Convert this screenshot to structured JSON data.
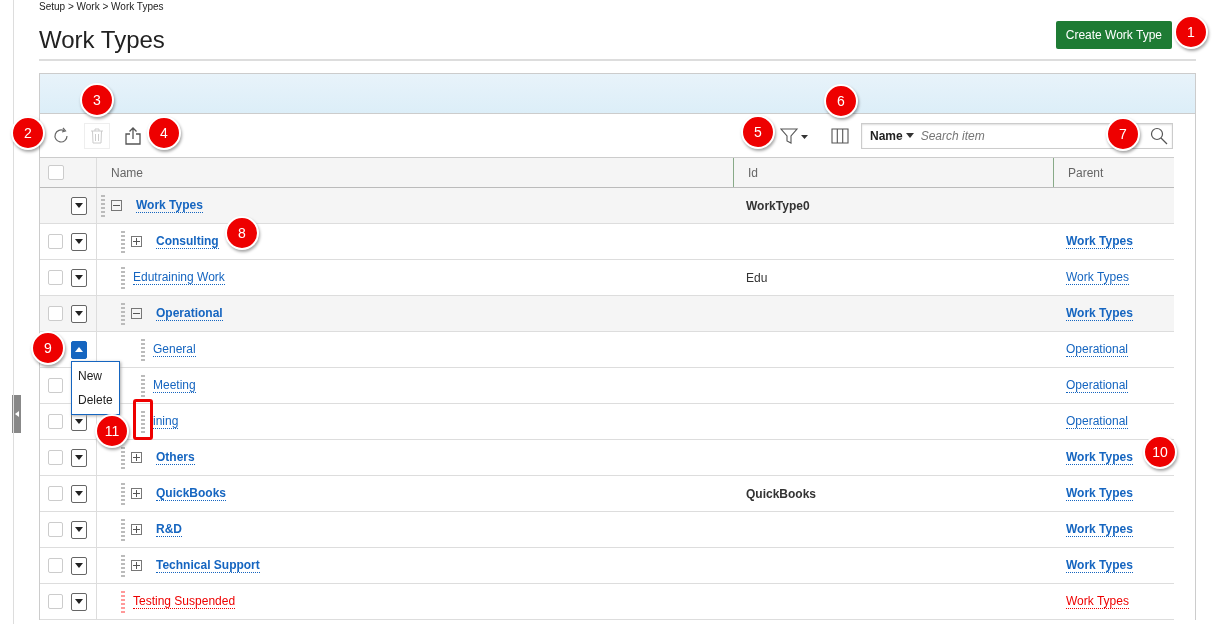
{
  "breadcrumb": "Setup > Work > Work Types",
  "title": "Work Types",
  "create_button": "Create Work Type",
  "search": {
    "field": "Name",
    "placeholder": "Search item"
  },
  "columns": [
    "Name",
    "Id",
    "Parent"
  ],
  "select_all_checked": false,
  "tree": [
    {
      "name": "Work Types",
      "id": "WorkType0",
      "expandable": true,
      "expanded": true,
      "suspended": false,
      "menu_open": false,
      "children": [
        {
          "name": "Consulting",
          "parent": "Work Types",
          "expandable": true,
          "expanded": false,
          "suspended": false,
          "checked": false,
          "menu_open": false
        },
        {
          "name": "Edutraining Work",
          "id": "Edu",
          "parent": "Work Types",
          "expandable": false,
          "expanded": false,
          "suspended": false,
          "checked": false,
          "menu_open": false
        },
        {
          "name": "Operational",
          "parent": "Work Types",
          "expandable": true,
          "expanded": true,
          "suspended": false,
          "checked": false,
          "menu_open": false,
          "children": [
            {
              "name": "General",
              "parent": "Operational",
              "expandable": false,
              "expanded": false,
              "suspended": false,
              "menu_open": true,
              "menu": [
                "New",
                "Delete"
              ]
            },
            {
              "name": "Meeting",
              "parent": "Operational",
              "expandable": false,
              "expanded": false,
              "suspended": false,
              "checked": false
            },
            {
              "name": "ining",
              "parent": "Operational",
              "expandable": false,
              "expanded": false,
              "suspended": false,
              "checked": false,
              "menu_open": false
            }
          ]
        },
        {
          "name": "Others",
          "parent": "Work Types",
          "expandable": true,
          "expanded": false,
          "suspended": false,
          "checked": false,
          "menu_open": false
        },
        {
          "name": "QuickBooks",
          "id": "QuickBooks",
          "parent": "Work Types",
          "expandable": true,
          "expanded": false,
          "suspended": false,
          "checked": false,
          "menu_open": false
        },
        {
          "name": "R&D",
          "parent": "Work Types",
          "expandable": true,
          "expanded": false,
          "suspended": false,
          "checked": false,
          "menu_open": false
        },
        {
          "name": "Technical Support",
          "parent": "Work Types",
          "expandable": true,
          "expanded": false,
          "suspended": false,
          "checked": false,
          "menu_open": false
        },
        {
          "name": "Testing Suspended",
          "parent": "Work Types",
          "expandable": false,
          "expanded": false,
          "suspended": true,
          "checked": false,
          "menu_open": false
        }
      ]
    }
  ],
  "callouts": [
    "1",
    "2",
    "3",
    "4",
    "5",
    "6",
    "7",
    "8",
    "9",
    "10",
    "11"
  ]
}
